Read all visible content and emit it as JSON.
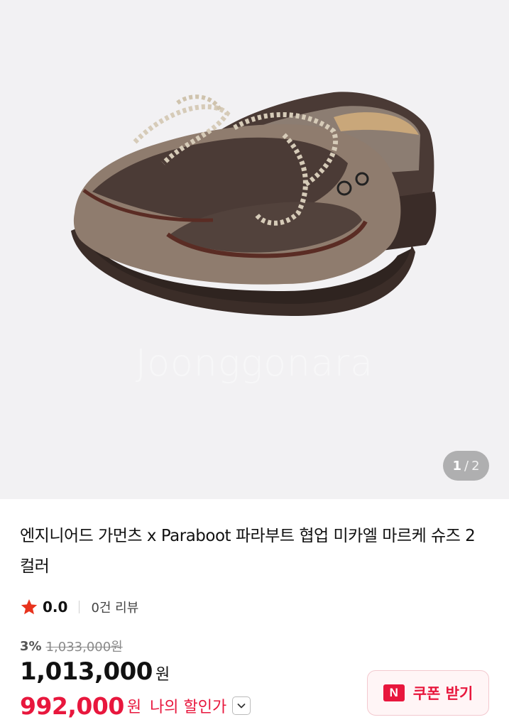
{
  "hero": {
    "watermark": "Joonggonara",
    "pager": {
      "current": "1",
      "separator": "/",
      "total": "2"
    }
  },
  "product": {
    "title": "엔지니어드 가먼츠 x Paraboot 파라부트 협업 미카엘 마르케 슈즈 2컬러",
    "rating": "0.0",
    "review_count": "0건 리뷰",
    "discount_rate": "3%",
    "original_price": "1,033,000원",
    "price": "1,013,000",
    "price_unit": "원",
    "my_price": "992,000",
    "my_price_unit": "원",
    "my_price_label": "나의 할인가"
  },
  "coupon": {
    "icon_letter": "N",
    "label": "쿠폰 받기"
  },
  "colors": {
    "accent": "#e8173d",
    "star": "#e8331d",
    "hero_bg": "#f2f1f3"
  },
  "icons": {
    "star": "star-icon",
    "chevron": "chevron-down-icon",
    "coupon": "naver-n-icon"
  }
}
